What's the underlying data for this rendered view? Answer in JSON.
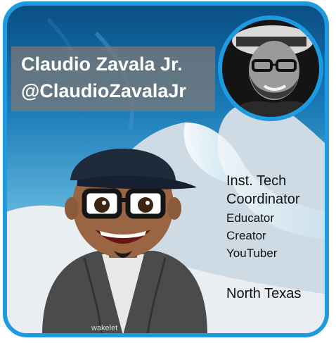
{
  "profile": {
    "name": "Claudio Zavala Jr.",
    "handle": "@ClaudioZavalaJr"
  },
  "details": {
    "title_line1": "Inst. Tech",
    "title_line2": "Coordinator",
    "roles": [
      "Educator",
      "Creator",
      "YouTuber"
    ],
    "location": "North Texas"
  },
  "hoodie_logo": "wakelet",
  "colors": {
    "border": "#1d9ae0",
    "name_band": "#7a7a7a",
    "cap": "#1f2a3a"
  }
}
